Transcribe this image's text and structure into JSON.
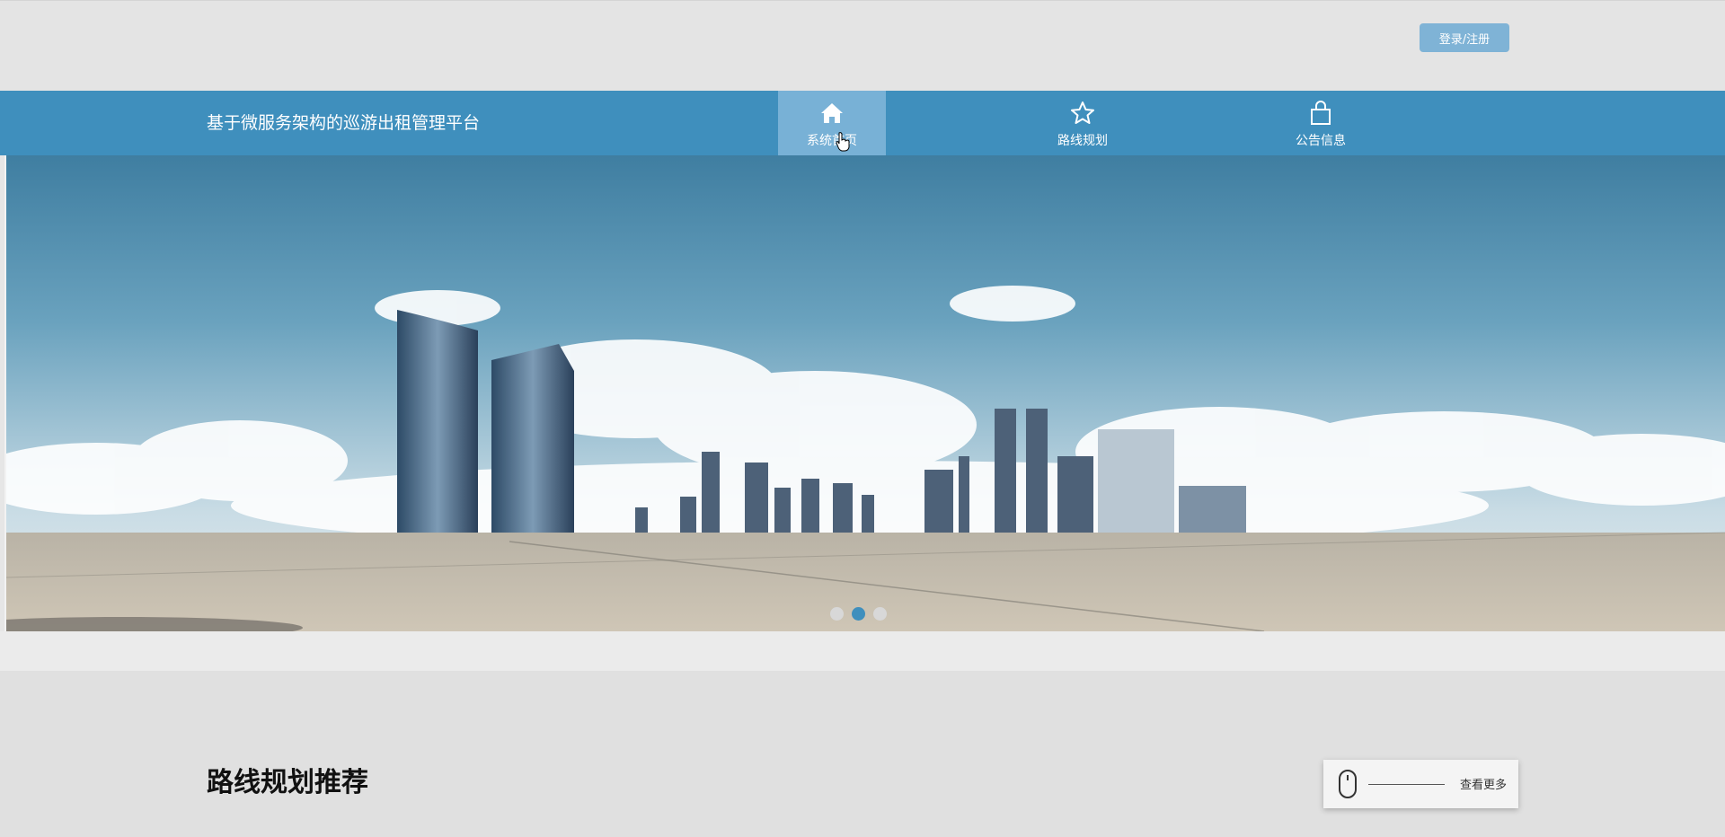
{
  "header": {
    "login_label": "登录/注册"
  },
  "nav": {
    "site_title": "基于微服务架构的巡游出租管理平台",
    "items": [
      {
        "label": "系统首页",
        "icon": "home-icon",
        "active": true
      },
      {
        "label": "路线规划",
        "icon": "star-icon",
        "active": false
      },
      {
        "label": "公告信息",
        "icon": "shopping-bag-icon",
        "active": false
      }
    ]
  },
  "carousel": {
    "slide_count": 3,
    "active_index": 1
  },
  "section": {
    "title": "路线规划推荐",
    "more_label": "查看更多",
    "more_icon": "mouse-icon"
  },
  "colors": {
    "nav_bg": "#3f8fbd",
    "nav_active": "#78b1d6",
    "login_btn": "#7fb3d6"
  }
}
